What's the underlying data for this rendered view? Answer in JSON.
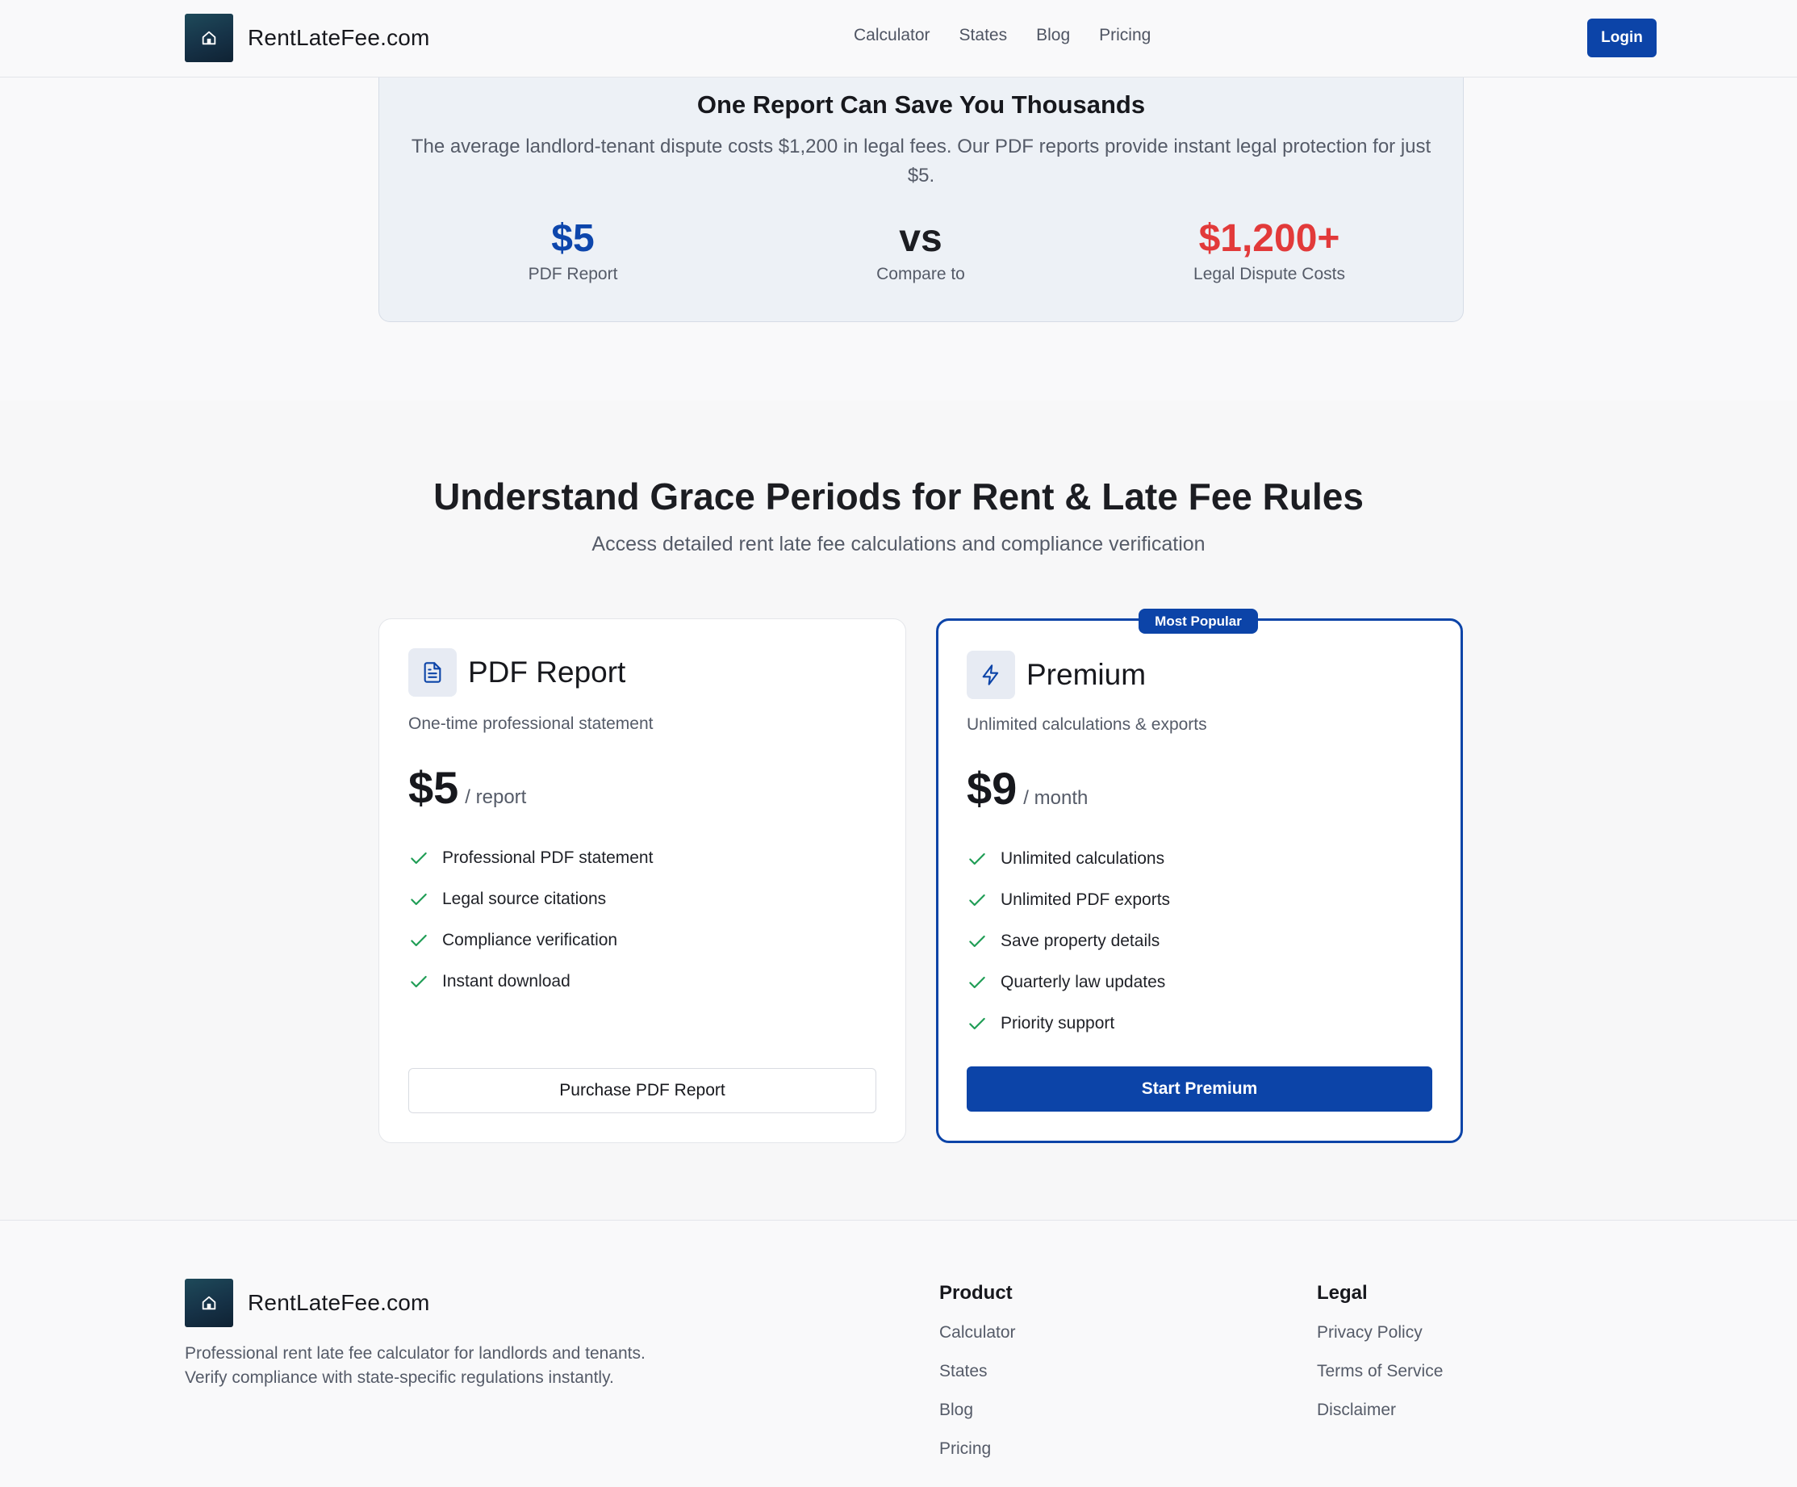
{
  "header": {
    "brand": "RentLateFee.com",
    "nav": [
      "Calculator",
      "States",
      "Blog",
      "Pricing"
    ],
    "login_label": "Login"
  },
  "savings": {
    "title": "One Report Can Save You Thousands",
    "text": "The average landlord-tenant dispute costs $1,200 in legal fees. Our PDF reports provide instant legal protection for just $5.",
    "stats": [
      {
        "value": "$5",
        "label": "PDF Report"
      },
      {
        "value": "vs",
        "label": "Compare to"
      },
      {
        "value": "$1,200+",
        "label": "Legal Dispute Costs"
      }
    ]
  },
  "pricing": {
    "title": "Understand Grace Periods for Rent & Late Fee Rules",
    "subtitle": "Access detailed rent late fee calculations and compliance verification",
    "badge": "Most Popular",
    "plans": [
      {
        "icon": "document-icon",
        "name": "PDF Report",
        "description": "One-time professional statement",
        "price": "$5",
        "period": "/ report",
        "features": [
          "Professional PDF statement",
          "Legal source citations",
          "Compliance verification",
          "Instant download"
        ],
        "cta": "Purchase PDF Report"
      },
      {
        "icon": "lightning-icon",
        "name": "Premium",
        "description": "Unlimited calculations & exports",
        "price": "$9",
        "period": "/ month",
        "features": [
          "Unlimited calculations",
          "Unlimited PDF exports",
          "Save property details",
          "Quarterly law updates",
          "Priority support"
        ],
        "cta": "Start Premium"
      }
    ]
  },
  "footer": {
    "brand": "RentLateFee.com",
    "description": "Professional rent late fee calculator for landlords and tenants. Verify compliance with state-specific regulations instantly.",
    "product": {
      "title": "Product",
      "links": [
        "Calculator",
        "States",
        "Blog",
        "Pricing"
      ]
    },
    "legal": {
      "title": "Legal",
      "links": [
        "Privacy Policy",
        "Terms of Service",
        "Disclaimer"
      ]
    }
  },
  "colors": {
    "accent": "#0c44a8",
    "danger": "#e23a3a",
    "check": "#1f9d55"
  }
}
